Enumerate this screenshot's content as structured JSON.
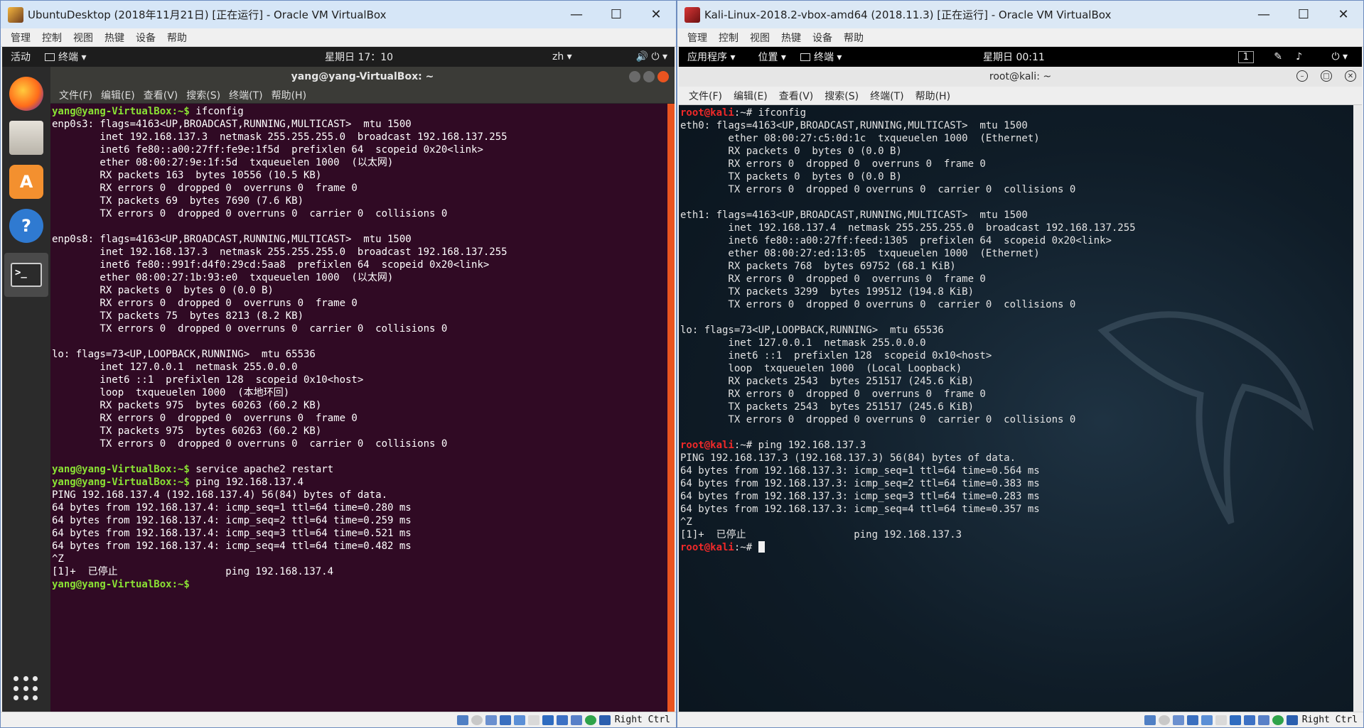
{
  "left_window": {
    "title": "UbuntuDesktop (2018年11月21日) [正在运行] - Oracle VM VirtualBox",
    "controls": [
      "—",
      "☐",
      "✕"
    ],
    "vb_menu": [
      "管理",
      "控制",
      "视图",
      "热键",
      "设备",
      "帮助"
    ],
    "topbar": {
      "activities": "活动",
      "app": "终端 ▾",
      "clock": "星期日 17：10",
      "lang": "zh ▾",
      "tray": "🔊 ⏻ ▾"
    },
    "terminal": {
      "title": "yang@yang-VirtualBox: ~",
      "menu": [
        "文件(F)",
        "编辑(E)",
        "查看(V)",
        "搜索(S)",
        "终端(T)",
        "帮助(H)"
      ],
      "prompt_user": "yang@yang-VirtualBox",
      "prompt_tail": ":~$",
      "lines": [
        {
          "kind": "prompt",
          "cmd": " ifconfig"
        },
        {
          "kind": "text",
          "text": "enp0s3: flags=4163<UP,BROADCAST,RUNNING,MULTICAST>  mtu 1500"
        },
        {
          "kind": "text",
          "text": "        inet 192.168.137.3  netmask 255.255.255.0  broadcast 192.168.137.255"
        },
        {
          "kind": "text",
          "text": "        inet6 fe80::a00:27ff:fe9e:1f5d  prefixlen 64  scopeid 0x20<link>"
        },
        {
          "kind": "text",
          "text": "        ether 08:00:27:9e:1f:5d  txqueuelen 1000  (以太网)"
        },
        {
          "kind": "text",
          "text": "        RX packets 163  bytes 10556 (10.5 KB)"
        },
        {
          "kind": "text",
          "text": "        RX errors 0  dropped 0  overruns 0  frame 0"
        },
        {
          "kind": "text",
          "text": "        TX packets 69  bytes 7690 (7.6 KB)"
        },
        {
          "kind": "text",
          "text": "        TX errors 0  dropped 0 overruns 0  carrier 0  collisions 0"
        },
        {
          "kind": "text",
          "text": ""
        },
        {
          "kind": "text",
          "text": "enp0s8: flags=4163<UP,BROADCAST,RUNNING,MULTICAST>  mtu 1500"
        },
        {
          "kind": "text",
          "text": "        inet 192.168.137.3  netmask 255.255.255.0  broadcast 192.168.137.255"
        },
        {
          "kind": "text",
          "text": "        inet6 fe80::991f:d4f0:29cd:5aa8  prefixlen 64  scopeid 0x20<link>"
        },
        {
          "kind": "text",
          "text": "        ether 08:00:27:1b:93:e0  txqueuelen 1000  (以太网)"
        },
        {
          "kind": "text",
          "text": "        RX packets 0  bytes 0 (0.0 B)"
        },
        {
          "kind": "text",
          "text": "        RX errors 0  dropped 0  overruns 0  frame 0"
        },
        {
          "kind": "text",
          "text": "        TX packets 75  bytes 8213 (8.2 KB)"
        },
        {
          "kind": "text",
          "text": "        TX errors 0  dropped 0 overruns 0  carrier 0  collisions 0"
        },
        {
          "kind": "text",
          "text": ""
        },
        {
          "kind": "text",
          "text": "lo: flags=73<UP,LOOPBACK,RUNNING>  mtu 65536"
        },
        {
          "kind": "text",
          "text": "        inet 127.0.0.1  netmask 255.0.0.0"
        },
        {
          "kind": "text",
          "text": "        inet6 ::1  prefixlen 128  scopeid 0x10<host>"
        },
        {
          "kind": "text",
          "text": "        loop  txqueuelen 1000  (本地环回)"
        },
        {
          "kind": "text",
          "text": "        RX packets 975  bytes 60263 (60.2 KB)"
        },
        {
          "kind": "text",
          "text": "        RX errors 0  dropped 0  overruns 0  frame 0"
        },
        {
          "kind": "text",
          "text": "        TX packets 975  bytes 60263 (60.2 KB)"
        },
        {
          "kind": "text",
          "text": "        TX errors 0  dropped 0 overruns 0  carrier 0  collisions 0"
        },
        {
          "kind": "text",
          "text": ""
        },
        {
          "kind": "prompt",
          "cmd": " service apache2 restart"
        },
        {
          "kind": "prompt",
          "cmd": " ping 192.168.137.4"
        },
        {
          "kind": "text",
          "text": "PING 192.168.137.4 (192.168.137.4) 56(84) bytes of data."
        },
        {
          "kind": "text",
          "text": "64 bytes from 192.168.137.4: icmp_seq=1 ttl=64 time=0.280 ms"
        },
        {
          "kind": "text",
          "text": "64 bytes from 192.168.137.4: icmp_seq=2 ttl=64 time=0.259 ms"
        },
        {
          "kind": "text",
          "text": "64 bytes from 192.168.137.4: icmp_seq=3 ttl=64 time=0.521 ms"
        },
        {
          "kind": "text",
          "text": "64 bytes from 192.168.137.4: icmp_seq=4 ttl=64 time=0.482 ms"
        },
        {
          "kind": "text",
          "text": "^Z"
        },
        {
          "kind": "text",
          "text": "[1]+  已停止                  ping 192.168.137.4"
        },
        {
          "kind": "prompt",
          "cmd": " "
        }
      ]
    },
    "status_right": "Right Ctrl"
  },
  "right_window": {
    "title": "Kali-Linux-2018.2-vbox-amd64 (2018.11.3) [正在运行] - Oracle VM VirtualBox",
    "controls": [
      "—",
      "☐",
      "✕"
    ],
    "vb_menu": [
      "管理",
      "控制",
      "视图",
      "热键",
      "设备",
      "帮助"
    ],
    "topbar": {
      "apps": "应用程序 ▾",
      "places": "位置 ▾",
      "app": "终端 ▾",
      "clock": "星期日 00:11",
      "workspace": "1"
    },
    "terminal": {
      "title": "root@kali: ~",
      "menu": [
        "文件(F)",
        "编辑(E)",
        "查看(V)",
        "搜索(S)",
        "终端(T)",
        "帮助(H)"
      ],
      "prompt_user": "root@kali",
      "prompt_tail": ":~#",
      "lines": [
        {
          "kind": "prompt",
          "cmd": " ifconfig"
        },
        {
          "kind": "text",
          "text": "eth0: flags=4163<UP,BROADCAST,RUNNING,MULTICAST>  mtu 1500"
        },
        {
          "kind": "text",
          "text": "        ether 08:00:27:c5:0d:1c  txqueuelen 1000  (Ethernet)"
        },
        {
          "kind": "text",
          "text": "        RX packets 0  bytes 0 (0.0 B)"
        },
        {
          "kind": "text",
          "text": "        RX errors 0  dropped 0  overruns 0  frame 0"
        },
        {
          "kind": "text",
          "text": "        TX packets 0  bytes 0 (0.0 B)"
        },
        {
          "kind": "text",
          "text": "        TX errors 0  dropped 0 overruns 0  carrier 0  collisions 0"
        },
        {
          "kind": "text",
          "text": ""
        },
        {
          "kind": "text",
          "text": "eth1: flags=4163<UP,BROADCAST,RUNNING,MULTICAST>  mtu 1500"
        },
        {
          "kind": "text",
          "text": "        inet 192.168.137.4  netmask 255.255.255.0  broadcast 192.168.137.255"
        },
        {
          "kind": "text",
          "text": "        inet6 fe80::a00:27ff:feed:1305  prefixlen 64  scopeid 0x20<link>"
        },
        {
          "kind": "text",
          "text": "        ether 08:00:27:ed:13:05  txqueuelen 1000  (Ethernet)"
        },
        {
          "kind": "text",
          "text": "        RX packets 768  bytes 69752 (68.1 KiB)"
        },
        {
          "kind": "text",
          "text": "        RX errors 0  dropped 0  overruns 0  frame 0"
        },
        {
          "kind": "text",
          "text": "        TX packets 3299  bytes 199512 (194.8 KiB)"
        },
        {
          "kind": "text",
          "text": "        TX errors 0  dropped 0 overruns 0  carrier 0  collisions 0"
        },
        {
          "kind": "text",
          "text": ""
        },
        {
          "kind": "text",
          "text": "lo: flags=73<UP,LOOPBACK,RUNNING>  mtu 65536"
        },
        {
          "kind": "text",
          "text": "        inet 127.0.0.1  netmask 255.0.0.0"
        },
        {
          "kind": "text",
          "text": "        inet6 ::1  prefixlen 128  scopeid 0x10<host>"
        },
        {
          "kind": "text",
          "text": "        loop  txqueuelen 1000  (Local Loopback)"
        },
        {
          "kind": "text",
          "text": "        RX packets 2543  bytes 251517 (245.6 KiB)"
        },
        {
          "kind": "text",
          "text": "        RX errors 0  dropped 0  overruns 0  frame 0"
        },
        {
          "kind": "text",
          "text": "        TX packets 2543  bytes 251517 (245.6 KiB)"
        },
        {
          "kind": "text",
          "text": "        TX errors 0  dropped 0 overruns 0  carrier 0  collisions 0"
        },
        {
          "kind": "text",
          "text": ""
        },
        {
          "kind": "prompt",
          "cmd": " ping 192.168.137.3"
        },
        {
          "kind": "text",
          "text": "PING 192.168.137.3 (192.168.137.3) 56(84) bytes of data."
        },
        {
          "kind": "text",
          "text": "64 bytes from 192.168.137.3: icmp_seq=1 ttl=64 time=0.564 ms"
        },
        {
          "kind": "text",
          "text": "64 bytes from 192.168.137.3: icmp_seq=2 ttl=64 time=0.383 ms"
        },
        {
          "kind": "text",
          "text": "64 bytes from 192.168.137.3: icmp_seq=3 ttl=64 time=0.283 ms"
        },
        {
          "kind": "text",
          "text": "64 bytes from 192.168.137.3: icmp_seq=4 ttl=64 time=0.357 ms"
        },
        {
          "kind": "text",
          "text": "^Z"
        },
        {
          "kind": "text",
          "text": "[1]+  已停止                  ping 192.168.137.3"
        },
        {
          "kind": "prompt",
          "cmd": " ",
          "cursor": true
        }
      ]
    },
    "status_right": "Right Ctrl"
  },
  "colors": {
    "ubuntu_bg": "#300a24",
    "ubuntu_prompt": "#8ae234",
    "kali_prompt_user": "#ef2929",
    "accent_orange": "#e95420"
  },
  "dock_icons": [
    "firefox-icon",
    "files-icon",
    "software-center-icon",
    "help-icon",
    "terminal-icon",
    "show-apps-icon"
  ]
}
